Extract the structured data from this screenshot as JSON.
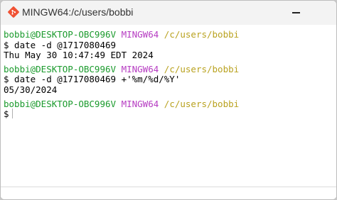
{
  "window": {
    "title": "MINGW64:/c/users/bobbi",
    "app_icon": "git-bash-icon"
  },
  "terminal": {
    "prompt1": {
      "user": "bobbi@DESKTOP-OBC996V",
      "system": "MINGW64",
      "path": "/c/users/bobbi"
    },
    "cmd1": "$ date -d @1717080469",
    "out1": "Thu May 30 10:47:49 EDT 2024",
    "prompt2": {
      "user": "bobbi@DESKTOP-OBC996V",
      "system": "MINGW64",
      "path": "/c/users/bobbi"
    },
    "cmd2": "$ date -d @1717080469 +'%m/%d/%Y'",
    "out2": "05/30/2024",
    "prompt3": {
      "user": "bobbi@DESKTOP-OBC996V",
      "system": "MINGW64",
      "path": "/c/users/bobbi"
    },
    "cmd3": "$"
  },
  "colors": {
    "user": "#1a9a2c",
    "system": "#b63cc2",
    "path": "#b9a21f"
  }
}
